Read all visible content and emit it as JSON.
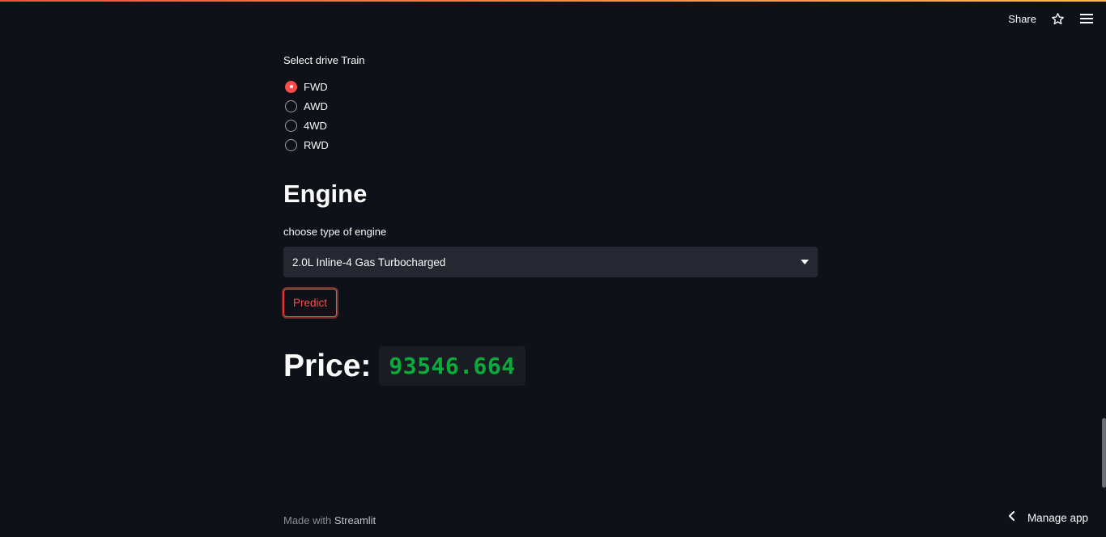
{
  "toolbar": {
    "share_label": "Share"
  },
  "drive_train": {
    "label": "Select drive Train",
    "options": [
      "FWD",
      "AWD",
      "4WD",
      "RWD"
    ],
    "selected": "FWD"
  },
  "engine": {
    "heading": "Engine",
    "select_label": "choose type of engine",
    "select_value": "2.0L Inline-4 Gas Turbocharged"
  },
  "predict_label": "Predict",
  "price": {
    "label": "Price:",
    "value": "93546.664"
  },
  "footer": {
    "made_with": "Made with",
    "brand": "Streamlit"
  },
  "manage_app_label": "Manage app",
  "colors": {
    "background": "#0e1117",
    "accent": "#ff4b4b",
    "price_green": "#09ab3b",
    "select_bg": "#262730"
  },
  "icons": {
    "star": "star-icon",
    "menu": "hamburger-menu-icon",
    "caret": "chevron-down-icon",
    "back": "chevron-left-icon"
  }
}
